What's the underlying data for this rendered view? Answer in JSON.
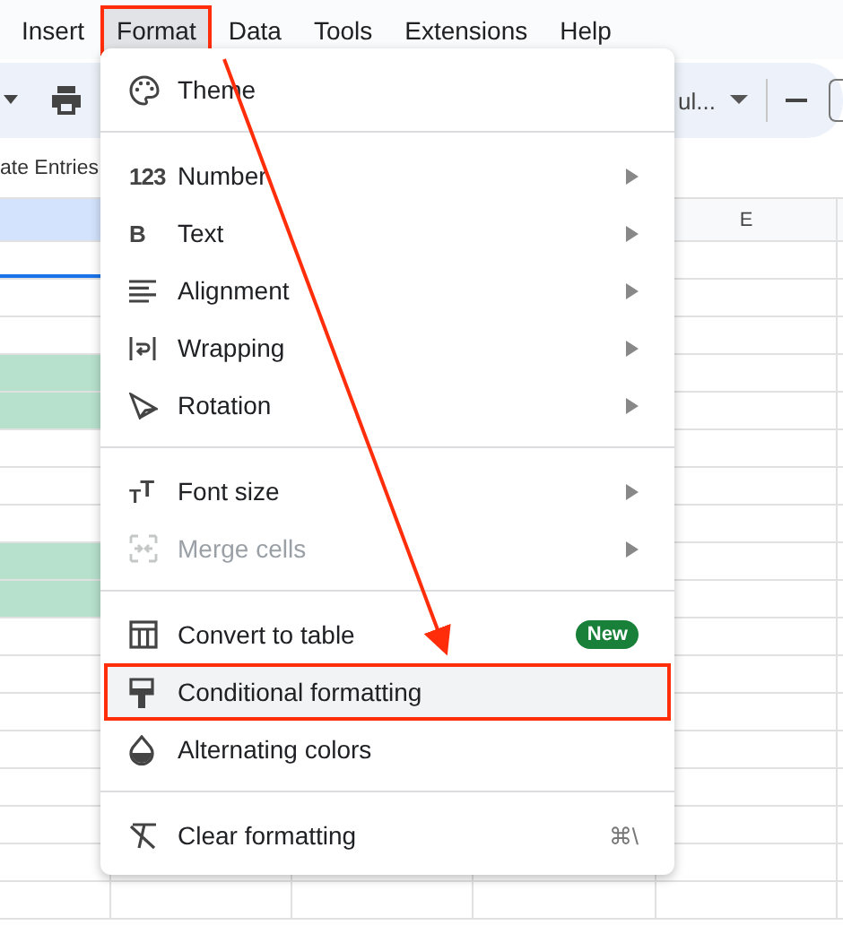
{
  "menu_bar": [
    {
      "label": "Insert",
      "selected": false,
      "annotated": false
    },
    {
      "label": "Format",
      "selected": true,
      "annotated": true
    },
    {
      "label": "Data",
      "selected": false,
      "annotated": false
    },
    {
      "label": "Tools",
      "selected": false,
      "annotated": false
    },
    {
      "label": "Extensions",
      "selected": false,
      "annotated": false
    },
    {
      "label": "Help",
      "selected": false,
      "annotated": false
    }
  ],
  "toolbar": {
    "font_name": "ul..."
  },
  "sheet_title": "ate Entries",
  "grid": {
    "columns": [
      {
        "selected": true
      },
      {
        "label": "E",
        "selected": false
      }
    ],
    "rows": [
      {
        "selected": true,
        "filled": false
      },
      {
        "selected": false,
        "filled": false
      },
      {
        "selected": false,
        "filled": false
      },
      {
        "selected": false,
        "filled": true
      },
      {
        "selected": false,
        "filled": true
      },
      {
        "selected": false,
        "filled": false
      },
      {
        "selected": false,
        "filled": false
      },
      {
        "selected": false,
        "filled": false
      },
      {
        "selected": false,
        "filled": true
      },
      {
        "selected": false,
        "filled": true
      },
      {
        "selected": false,
        "filled": false
      },
      {
        "selected": false,
        "filled": false
      },
      {
        "selected": false,
        "filled": false
      },
      {
        "selected": false,
        "filled": false
      },
      {
        "selected": false,
        "filled": false
      },
      {
        "selected": false,
        "filled": false
      },
      {
        "selected": false,
        "filled": false
      },
      {
        "selected": false,
        "filled": false
      }
    ]
  },
  "format_menu": [
    {
      "kind": "item",
      "label": "Theme",
      "submenu": false,
      "disabled": false,
      "highlighted": false,
      "annotated": false
    },
    {
      "kind": "divider"
    },
    {
      "kind": "item",
      "label": "Number",
      "icon_text": "123",
      "submenu": true,
      "disabled": false,
      "highlighted": false,
      "annotated": false
    },
    {
      "kind": "item",
      "label": "Text",
      "icon_text": "B",
      "submenu": true,
      "disabled": false,
      "highlighted": false,
      "annotated": false
    },
    {
      "kind": "item",
      "label": "Alignment",
      "submenu": true,
      "disabled": false,
      "highlighted": false,
      "annotated": false
    },
    {
      "kind": "item",
      "label": "Wrapping",
      "submenu": true,
      "disabled": false,
      "highlighted": false,
      "annotated": false
    },
    {
      "kind": "item",
      "label": "Rotation",
      "submenu": true,
      "disabled": false,
      "highlighted": false,
      "annotated": false
    },
    {
      "kind": "divider"
    },
    {
      "kind": "item",
      "label": "Font size",
      "icon_text": "$_{T}$T",
      "submenu": true,
      "disabled": false,
      "highlighted": false,
      "annotated": false
    },
    {
      "kind": "item",
      "label": "Merge cells",
      "submenu": true,
      "disabled": true,
      "highlighted": false,
      "annotated": false
    },
    {
      "kind": "divider"
    },
    {
      "kind": "item",
      "label": "Convert to table",
      "badge": "New",
      "submenu": false,
      "disabled": false,
      "highlighted": false,
      "annotated": false
    },
    {
      "kind": "item",
      "label": "Conditional formatting",
      "submenu": false,
      "disabled": false,
      "highlighted": true,
      "annotated": true
    },
    {
      "kind": "item",
      "label": "Alternating colors",
      "submenu": false,
      "disabled": false,
      "highlighted": false,
      "annotated": false
    },
    {
      "kind": "divider"
    },
    {
      "kind": "item",
      "label": "Clear formatting",
      "shortcut": "⌘\\",
      "submenu": false,
      "disabled": false,
      "highlighted": false,
      "annotated": false
    }
  ]
}
